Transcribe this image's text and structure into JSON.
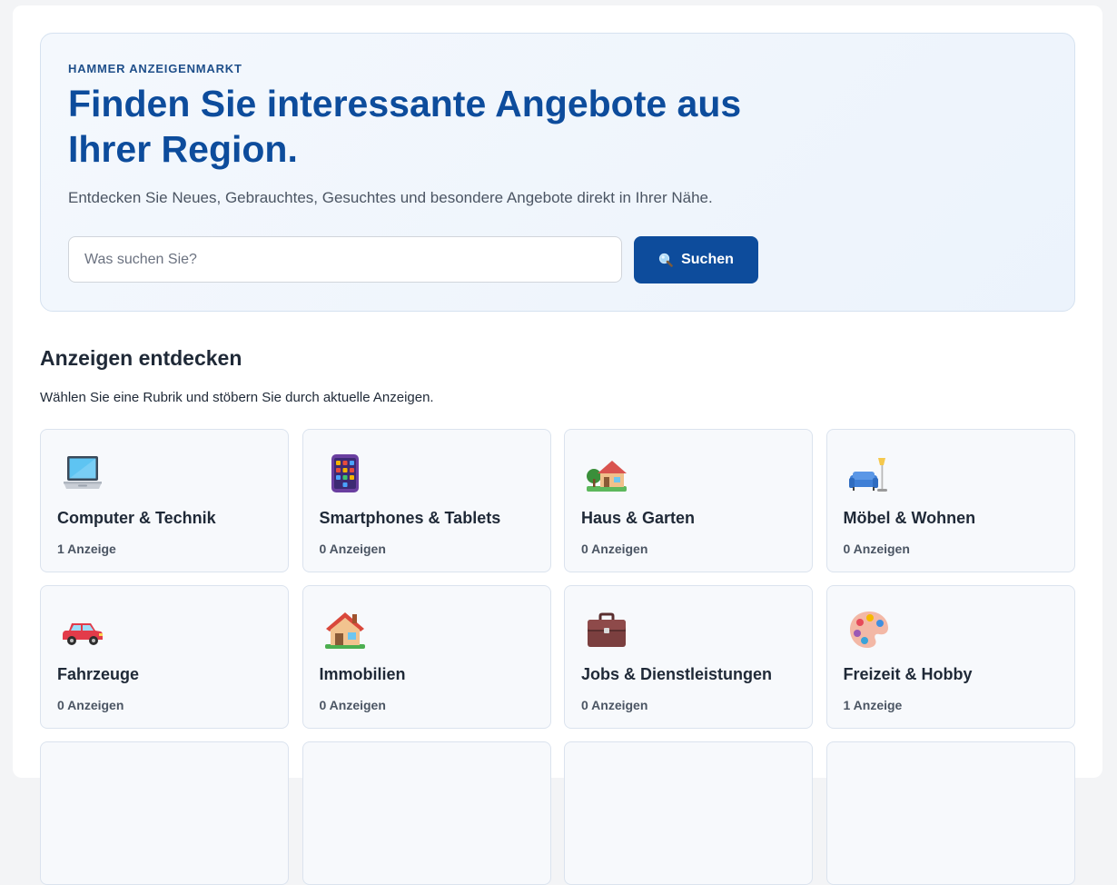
{
  "hero": {
    "eyebrow": "HAMMER ANZEIGENMARKT",
    "title": "Finden Sie interessante Angebote aus Ihrer Region.",
    "subtitle": "Entdecken Sie Neues, Gebrauchtes, Gesuchtes und besondere Angebote direkt in Ihrer Nähe.",
    "search": {
      "placeholder": "Was suchen Sie?",
      "value": "",
      "button_label": "Suchen",
      "button_icon": "magnifier-icon"
    }
  },
  "section": {
    "title": "Anzeigen entdecken",
    "subtitle": "Wählen Sie eine Rubrik und stöbern Sie durch aktuelle Anzeigen."
  },
  "categories": [
    {
      "label": "Computer & Technik",
      "count": "1 Anzeige",
      "icon": "laptop-icon"
    },
    {
      "label": "Smartphones & Tablets",
      "count": "0 Anzeigen",
      "icon": "phone-icon"
    },
    {
      "label": "Haus & Garten",
      "count": "0 Anzeigen",
      "icon": "house-garden-icon"
    },
    {
      "label": "Möbel & Wohnen",
      "count": "0 Anzeigen",
      "icon": "sofa-lamp-icon"
    },
    {
      "label": "Fahrzeuge",
      "count": "0 Anzeigen",
      "icon": "car-icon"
    },
    {
      "label": "Immobilien",
      "count": "0 Anzeigen",
      "icon": "house-icon"
    },
    {
      "label": "Jobs & Dienstleistungen",
      "count": "0 Anzeigen",
      "icon": "briefcase-icon"
    },
    {
      "label": "Freizeit & Hobby",
      "count": "1 Anzeige",
      "icon": "palette-icon"
    }
  ],
  "colors": {
    "brand": "#0d4c9c",
    "hero_bg": "#eef4fc",
    "card_bg": "#f7f9fc"
  }
}
